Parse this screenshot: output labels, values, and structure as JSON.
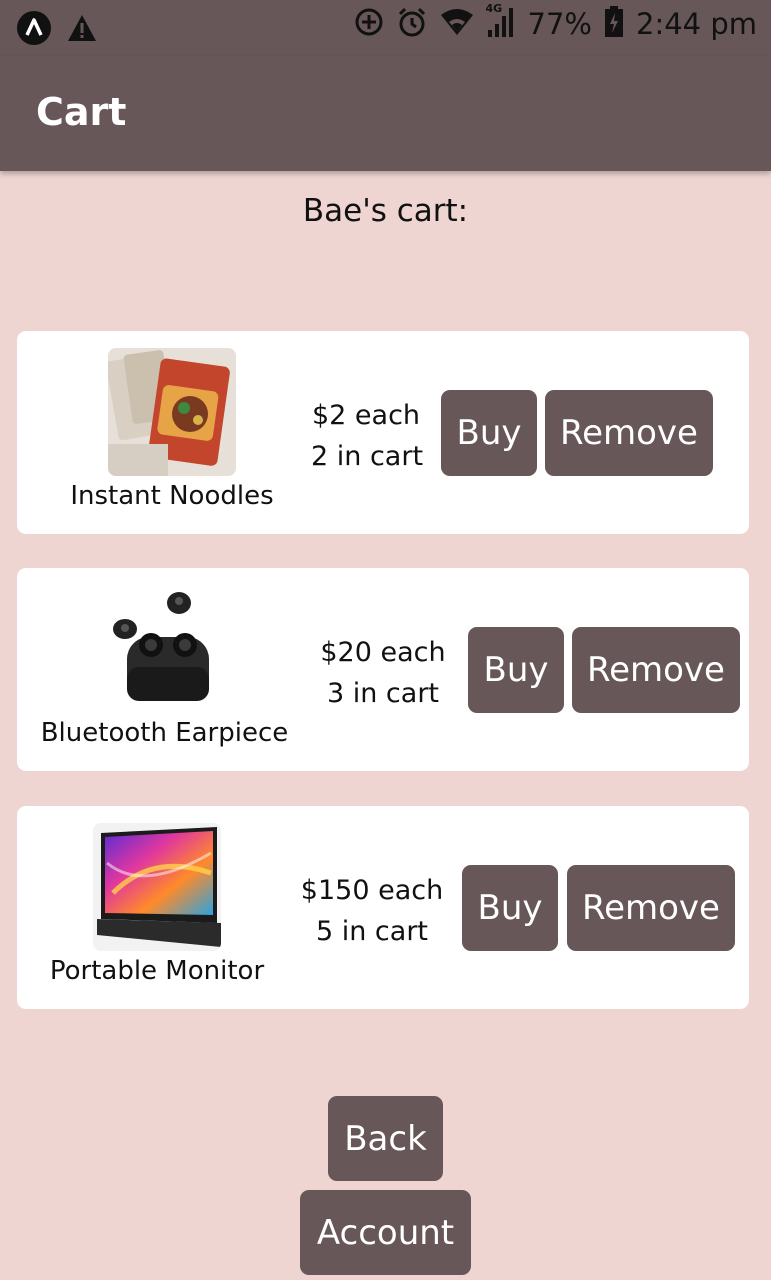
{
  "status_bar": {
    "battery": "77%",
    "network": "4G",
    "time": "2:44 pm"
  },
  "app_bar": {
    "title": "Cart"
  },
  "cart": {
    "heading": "Bae's cart:",
    "items": [
      {
        "name": "Instant Noodles",
        "price": "$2 each",
        "qty": "2 in cart",
        "buy": "Buy",
        "remove": "Remove",
        "image": "noodles-package"
      },
      {
        "name": "Bluetooth Earpiece",
        "price": "$20 each",
        "qty": "3 in cart",
        "buy": "Buy",
        "remove": "Remove",
        "image": "earbuds-with-case"
      },
      {
        "name": "Portable Monitor",
        "price": "$150 each",
        "qty": "5 in cart",
        "buy": "Buy",
        "remove": "Remove",
        "image": "portable-monitor"
      }
    ]
  },
  "nav": {
    "back": "Back",
    "account": "Account"
  },
  "colors": {
    "primary": "#675759",
    "background": "#eed5d2",
    "card": "#ffffff"
  }
}
